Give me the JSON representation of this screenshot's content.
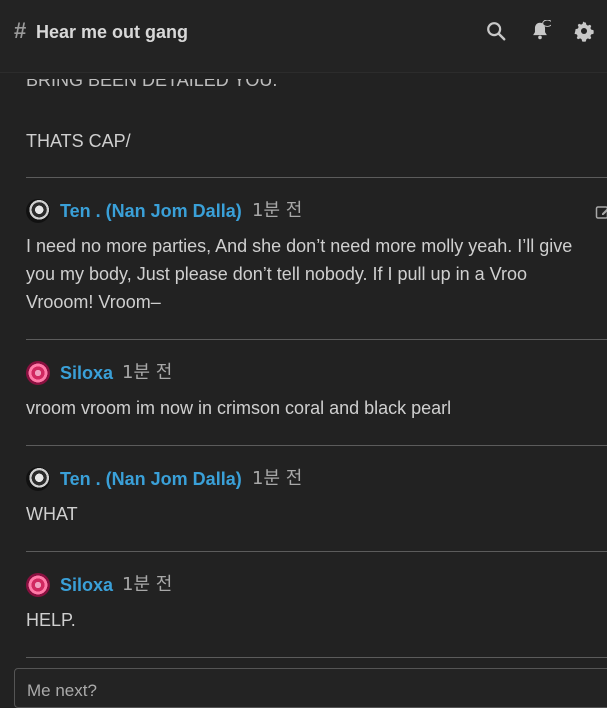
{
  "header": {
    "channel_name": "Hear me out gang",
    "icons": [
      "search-icon",
      "bell-icon",
      "gear-icon"
    ]
  },
  "messages": [
    {
      "text": "THATS CAP/"
    },
    {
      "author": "Ten . (Nan Jom Dalla)",
      "time": "1분 전",
      "lines": [
        "I need no more parties, And she don’t need more molly yeah. I’ll give",
        "you my body, Just please don’t tell nobody. If I pull up in a Vroo",
        "Vrooom! Vroom–"
      ]
    },
    {
      "author": "Siloxa",
      "time": "1분 전",
      "text": "vroom vroom im now in crimson coral and black pearl"
    },
    {
      "author": "Ten . (Nan Jom Dalla)",
      "time": "1분 전",
      "text": "WHAT"
    },
    {
      "author": "Siloxa",
      "time": "1분 전",
      "text": "HELP."
    }
  ],
  "composer": {
    "placeholder": "Me next?"
  },
  "colors": {
    "author": "#3aa0d8",
    "background": "#222222"
  }
}
